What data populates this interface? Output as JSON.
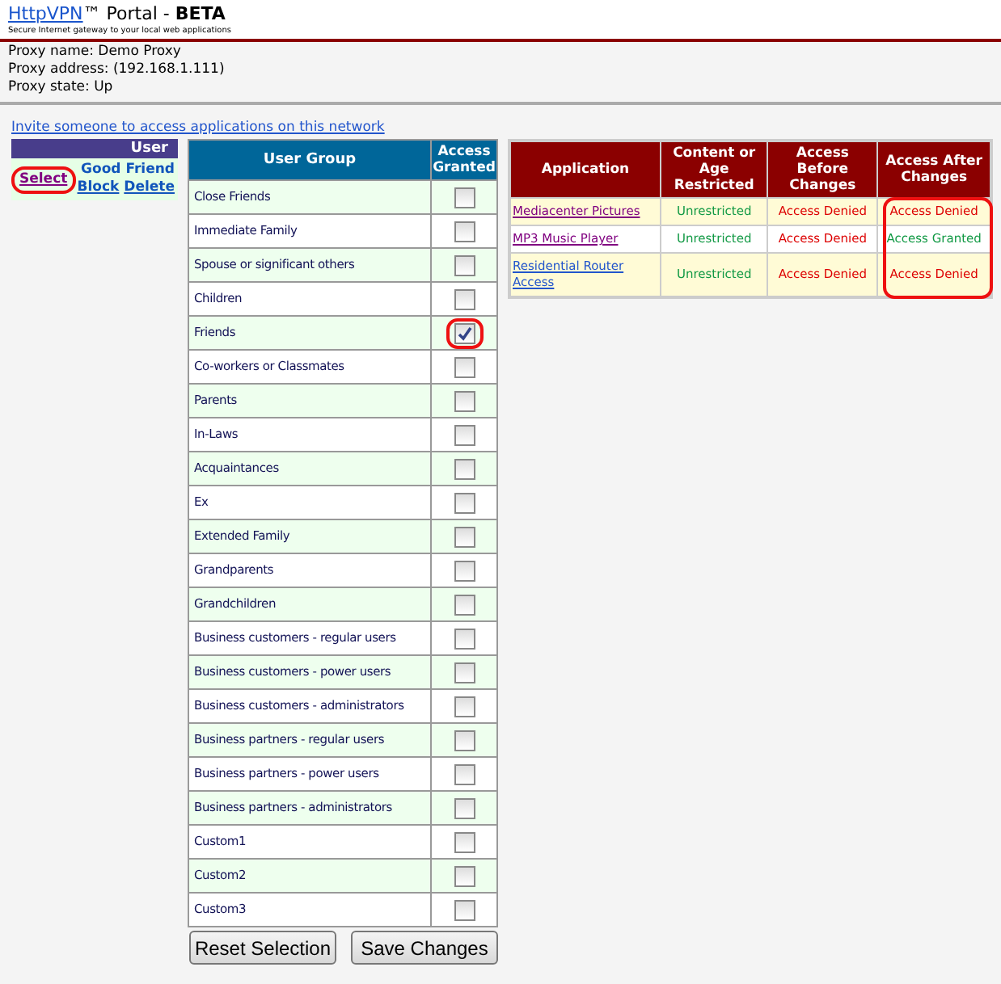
{
  "header": {
    "brand": "HttpVPN",
    "title": "™ Portal - **BETA**",
    "tagline": "Secure Internet gateway to your local web applications"
  },
  "proxy": [
    "Proxy name: Demo Proxy",
    "Proxy address: (192.168.1.111)",
    "Proxy state: Up"
  ],
  "invite_link": "Invite someone to access applications on this network",
  "users": {
    "heading": "User",
    "rows": [
      {
        "select": "Select",
        "name": "Good Friend",
        "block": "Block",
        "delete": "Delete",
        "highlighted": true
      }
    ]
  },
  "groups": {
    "columns": [
      "User Group",
      "Access Granted"
    ],
    "rows": [
      {
        "name": "Close Friends",
        "checked": false,
        "highlighted": false
      },
      {
        "name": "Immediate Family",
        "checked": false,
        "highlighted": false
      },
      {
        "name": "Spouse or significant others",
        "checked": false,
        "highlighted": false
      },
      {
        "name": "Children",
        "checked": false,
        "highlighted": false
      },
      {
        "name": "Friends",
        "checked": true,
        "highlighted": true
      },
      {
        "name": "Co-workers or Classmates",
        "checked": false,
        "highlighted": false
      },
      {
        "name": "Parents",
        "checked": false,
        "highlighted": false
      },
      {
        "name": "In-Laws",
        "checked": false,
        "highlighted": false
      },
      {
        "name": "Acquaintances",
        "checked": false,
        "highlighted": false
      },
      {
        "name": "Ex",
        "checked": false,
        "highlighted": false
      },
      {
        "name": "Extended Family",
        "checked": false,
        "highlighted": false
      },
      {
        "name": "Grandparents",
        "checked": false,
        "highlighted": false
      },
      {
        "name": "Grandchildren",
        "checked": false,
        "highlighted": false
      },
      {
        "name": "Business customers - regular users",
        "checked": false,
        "highlighted": false
      },
      {
        "name": "Business customers - power users",
        "checked": false,
        "highlighted": false
      },
      {
        "name": "Business customers - administrators",
        "checked": false,
        "highlighted": false
      },
      {
        "name": "Business partners - regular users",
        "checked": false,
        "highlighted": false
      },
      {
        "name": "Business partners - power users",
        "checked": false,
        "highlighted": false
      },
      {
        "name": "Business partners - administrators",
        "checked": false,
        "highlighted": false
      },
      {
        "name": "Custom1",
        "checked": false,
        "highlighted": false
      },
      {
        "name": "Custom2",
        "checked": false,
        "highlighted": false
      },
      {
        "name": "Custom3",
        "checked": false,
        "highlighted": false
      }
    ]
  },
  "applications": {
    "columns": [
      "Application",
      "Content or Age Restricted",
      "Access Before Changes",
      "Access After Changes"
    ],
    "after_highlighted": true,
    "rows": [
      {
        "name": "Mediacenter Pictures",
        "visited": true,
        "restriction": {
          "text": "Unrestricted",
          "kind": "ok"
        },
        "before": {
          "text": "Access Denied",
          "kind": "denied"
        },
        "after": {
          "text": "Access Denied",
          "kind": "denied"
        }
      },
      {
        "name": "MP3 Music Player",
        "visited": true,
        "restriction": {
          "text": "Unrestricted",
          "kind": "ok"
        },
        "before": {
          "text": "Access Denied",
          "kind": "denied"
        },
        "after": {
          "text": "Access Granted",
          "kind": "ok"
        }
      },
      {
        "name": "Residential Router Access",
        "visited": false,
        "restriction": {
          "text": "Unrestricted",
          "kind": "ok"
        },
        "before": {
          "text": "Access Denied",
          "kind": "denied"
        },
        "after": {
          "text": "Access Denied",
          "kind": "denied"
        }
      }
    ]
  },
  "buttons": [
    "Reset Selection",
    "Save Changes"
  ]
}
